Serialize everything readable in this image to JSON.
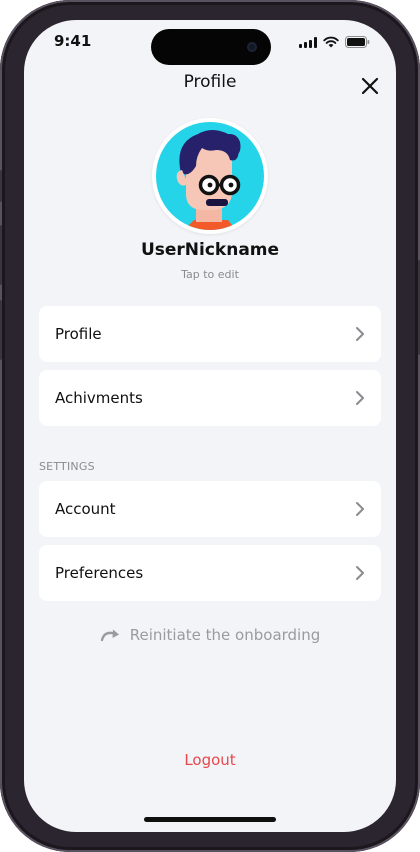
{
  "status": {
    "time": "9:41"
  },
  "header": {
    "title": "Profile"
  },
  "user": {
    "nickname": "UserNickname",
    "edit_hint": "Tap to edit"
  },
  "menu": {
    "items": [
      {
        "label": "Profile"
      },
      {
        "label": "Achivments"
      }
    ]
  },
  "settings": {
    "section_label": "SETTINGS",
    "items": [
      {
        "label": "Account"
      },
      {
        "label": "Preferences"
      }
    ]
  },
  "onboarding": {
    "label": "Reinitiate the onboarding"
  },
  "logout": {
    "label": "Logout"
  },
  "colors": {
    "background": "#f3f4f8",
    "avatar_bg": "#26d4ea",
    "logout": "#e5484d",
    "muted": "#9a9aa0"
  },
  "icons": [
    "close-icon",
    "chevron-right-icon",
    "redo-arrow-icon",
    "signal-icon",
    "wifi-icon",
    "battery-icon"
  ]
}
